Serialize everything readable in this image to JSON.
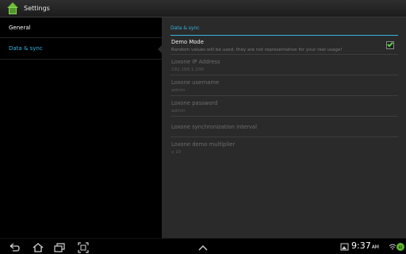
{
  "window": {
    "title": "Settings"
  },
  "sidebar": {
    "items": [
      {
        "label": "General"
      },
      {
        "label": "Data & sync"
      }
    ]
  },
  "panel": {
    "section_title": "Data & sync",
    "demo_mode": {
      "title": "Demo Mode",
      "summary": "Random values will be used, they are not representative for your real usage!",
      "checked": true
    },
    "ip_address": {
      "title": "Loxone IP Address",
      "value": "192.168.1.200"
    },
    "username": {
      "title": "Loxone username",
      "value": "admin"
    },
    "password": {
      "title": "Loxone password",
      "value": "admin"
    },
    "interval": {
      "title": "Loxone synchronization interval"
    },
    "multiplier": {
      "title": "Loxone demo multiplier",
      "value": "x 10"
    }
  },
  "statusbar": {
    "time": "9:37",
    "period": "AM",
    "battery": "82"
  },
  "icons": [
    "app-home-icon",
    "back-icon",
    "home-icon",
    "recent-apps-icon",
    "screenshot-icon",
    "chevron-up-icon",
    "gallery-icon",
    "wifi-icon",
    "battery-icon"
  ],
  "colors": {
    "accent": "#33b5e5",
    "check": "#5fd04a",
    "panel_bg": "#2a2a2a"
  }
}
